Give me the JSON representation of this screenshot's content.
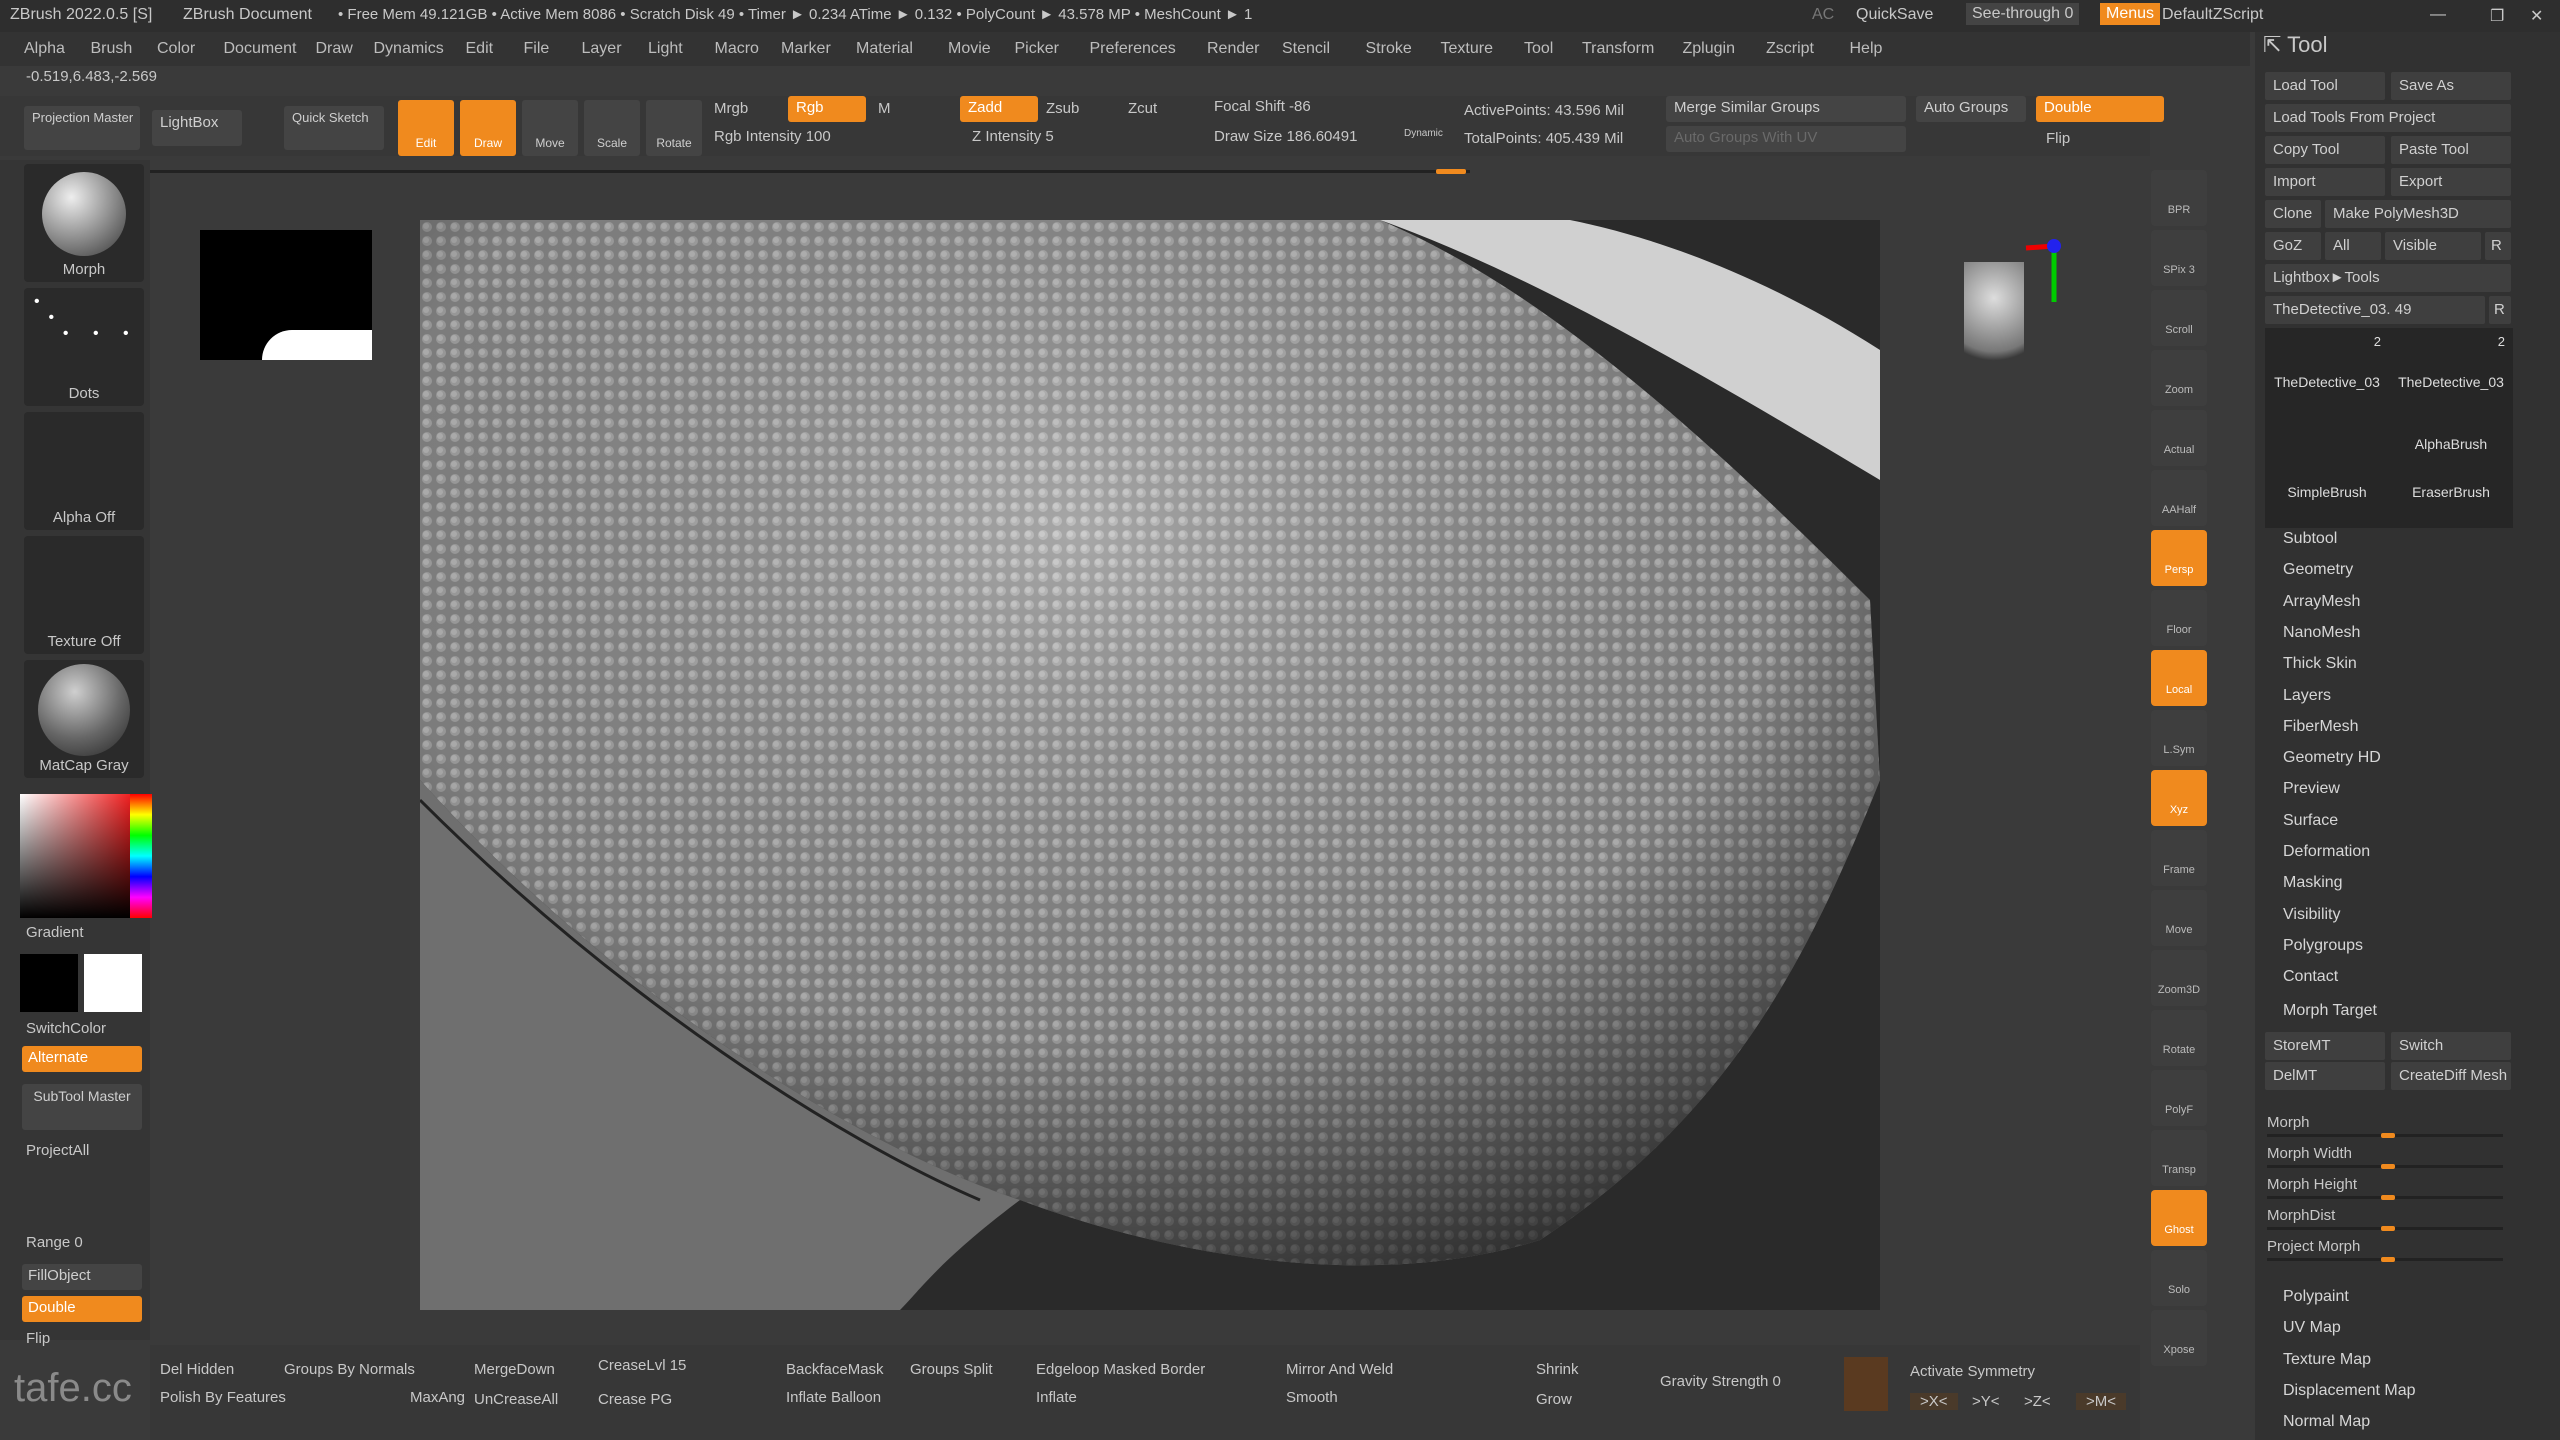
{
  "titlebar": {
    "app": "ZBrush 2022.0.5 [S]",
    "document": "ZBrush Document",
    "stats": "• Free Mem 49.121GB • Active Mem 8086 • Scratch Disk 49 • Timer ► 0.234 ATime ► 0.132 • PolyCount ► 43.578 MP • MeshCount ► 1",
    "ac": "AC",
    "quicksave": "QuickSave",
    "seethrough": "See-through 0",
    "menus": "Menus",
    "script": "DefaultZScript"
  },
  "menu": [
    "Alpha",
    "Brush",
    "Color",
    "Document",
    "Draw",
    "Dynamics",
    "Edit",
    "File",
    "Layer",
    "Light",
    "Macro",
    "Marker",
    "Material",
    "Movie",
    "Picker",
    "Preferences",
    "Render",
    "Stencil",
    "Stroke",
    "Texture",
    "Tool",
    "Transform",
    "Zplugin",
    "Zscript",
    "Help"
  ],
  "coords": "-0.519,6.483,-2.569",
  "toolbar": {
    "projection_master": "Projection Master",
    "lightbox": "LightBox",
    "quick_sketch": "Quick Sketch",
    "edit": "Edit",
    "draw": "Draw",
    "move": "Move",
    "scale": "Scale",
    "rotate": "Rotate",
    "mrgb": "Mrgb",
    "rgb": "Rgb",
    "m": "M",
    "rgb_intensity": "Rgb Intensity 100",
    "zadd": "Zadd",
    "zsub": "Zsub",
    "zcut": "Zcut",
    "z_intensity": "Z Intensity 5",
    "focal_shift": "Focal Shift -86",
    "draw_size": "Draw Size 186.60491",
    "dynamic": "Dynamic",
    "active_points": "ActivePoints: 43.596 Mil",
    "total_points": "TotalPoints: 405.439 Mil",
    "merge_similar": "Merge Similar Groups",
    "auto_groups_uv": "Auto Groups With UV",
    "auto_groups": "Auto Groups",
    "double": "Double",
    "flip": "Flip"
  },
  "left": {
    "morph": "Morph",
    "dots": "Dots",
    "alpha_off": "Alpha Off",
    "texture_off": "Texture Off",
    "matcap": "MatCap Gray",
    "gradient": "Gradient",
    "switchcolor": "SwitchColor",
    "alternate": "Alternate",
    "subtool_master": "SubTool Master",
    "projectall": "ProjectAll",
    "range": "Range 0",
    "fillobject": "FillObject",
    "double": "Double",
    "flip": "Flip",
    "watermark": "tafe.cc"
  },
  "shelf": [
    "BPR",
    "SPix 3",
    "Scroll",
    "Zoom",
    "Actual",
    "AAHalf",
    "Persp",
    "Floor",
    "Local",
    "L.Sym",
    "Xyz",
    "Frame",
    "Move",
    "Zoom3D",
    "Rotate",
    "PolyF",
    "Transp",
    "Ghost",
    "Solo",
    "Xpose"
  ],
  "tool": {
    "header": "Tool",
    "load_tool": "Load Tool",
    "save_as": "Save As",
    "load_from_project": "Load Tools From Project",
    "copy_tool": "Copy Tool",
    "paste_tool": "Paste Tool",
    "import": "Import",
    "export": "Export",
    "clone": "Clone",
    "make_polymesh": "Make PolyMesh3D",
    "goz": "GoZ",
    "all": "All",
    "visible": "Visible",
    "r": "R",
    "lightbox_tools": "Lightbox►Tools",
    "current_tool": "TheDetective_03. 49",
    "thumbs": [
      {
        "name": "TheDetective_03",
        "count": "2"
      },
      {
        "name": "TheDetective_03",
        "count": "2"
      },
      {
        "name": "AlphaBrush",
        "count": ""
      },
      {
        "name": "SimpleBrush",
        "count": ""
      },
      {
        "name": "EraserBrush",
        "count": ""
      }
    ],
    "sections": [
      "Subtool",
      "Geometry",
      "ArrayMesh",
      "NanoMesh",
      "Thick Skin",
      "Layers",
      "FiberMesh",
      "Geometry HD",
      "Preview",
      "Surface",
      "Deformation",
      "Masking",
      "Visibility",
      "Polygroups",
      "Contact"
    ],
    "morph_target": "Morph Target",
    "storemt": "StoreMT",
    "switch": "Switch",
    "delmt": "DelMT",
    "creatediff": "CreateDiff Mesh",
    "morph_sliders": [
      "Morph",
      "Morph Width",
      "Morph Height",
      "MorphDist",
      "Project Morph"
    ],
    "sections2": [
      "Polypaint",
      "UV Map",
      "Texture Map",
      "Displacement Map",
      "Normal Map"
    ]
  },
  "bottom": {
    "del_hidden": "Del Hidden",
    "polish_features": "Polish By Features",
    "groups_normals": "Groups By Normals",
    "maxang": "MaxAng",
    "mergedown": "MergeDown",
    "uncreaseall": "UnCreaseAll",
    "creaselvl": "CreaseLvl 15",
    "crease_pg": "Crease PG",
    "backfacemask": "BackfaceMask",
    "groups_split": "Groups Split",
    "inflate_balloon": "Inflate Balloon",
    "edgeloop": "Edgeloop Masked Border",
    "inflate": "Inflate",
    "mirror_weld": "Mirror And Weld",
    "smooth": "Smooth",
    "shrink": "Shrink",
    "grow": "Grow",
    "gravity": "Gravity Strength 0",
    "activate_symmetry": "Activate Symmetry",
    "x": ">X<",
    "y": ">Y<",
    "z": ">Z<",
    "m": ">M<"
  },
  "colors": {
    "accent": "#f08a1e",
    "panel": "#353535",
    "viewport": "#1c1c1c"
  }
}
